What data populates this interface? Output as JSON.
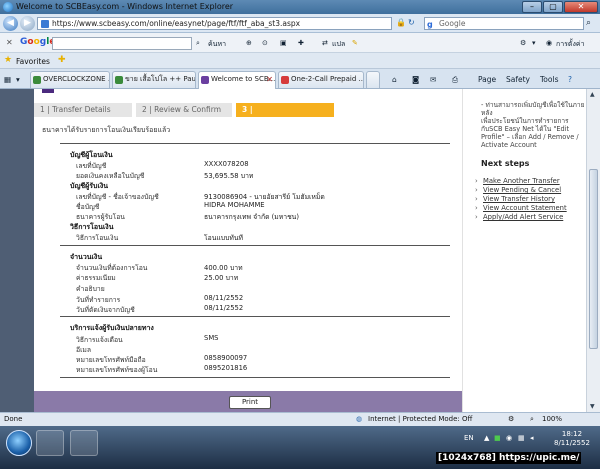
{
  "window": {
    "title": "Welcome to SCBEasy.com - Windows Internet Explorer",
    "minimize": "–",
    "maximize": "▢",
    "close": "✕"
  },
  "address": {
    "url": "https://www.scbeasy.com/online/easynet/page/ftf/ftf_aba_st3.aspx",
    "search_placeholder": "Google"
  },
  "google_bar": {
    "close": "✕",
    "logo": [
      "G",
      "o",
      "o",
      "g",
      "l",
      "e"
    ],
    "search_label": "ค้นหา",
    "translate": "แปล",
    "settings": "การตั้งค่า"
  },
  "favorites": {
    "label": "Favorites"
  },
  "tabs": [
    {
      "label": "OVERCLOCKZONE ...",
      "icon_color": "#3b8b3b"
    },
    {
      "label": "ขาย เสื้อโปโล ++ Paul...",
      "icon_color": "#3b8b3b"
    },
    {
      "label": "Welcome to SCB...",
      "icon_color": "#6b3fa0",
      "active": true
    },
    {
      "label": "One-2-Call Prepaid ...",
      "icon_color": "#d63b3b"
    }
  ],
  "commands": {
    "page": "Page",
    "safety": "Safety",
    "tools": "Tools"
  },
  "steps": [
    {
      "label": "1 | Transfer Details"
    },
    {
      "label": "2 | Review & Confirm"
    },
    {
      "label": "3 | Acknowledgements",
      "active": true
    }
  ],
  "success_message": "ธนาคารได้รับรายการโอนเงินเรียบร้อยแล้ว",
  "from_account": {
    "section": "บัญชีผู้โอนเงิน",
    "number_label": "เลขที่บัญชี",
    "number": "XXXX078208",
    "balance_label": "ยอดเงินคงเหลือในบัญชี",
    "balance": "53,695.58 บาท"
  },
  "to_account": {
    "section": "บัญชีผู้รับเงิน",
    "number_label": "เลขที่บัญชี - ชื่อเจ้าของบัญชี",
    "number": "9130086904 - นายอัยสารีย์ โมฮัมเหม็ด",
    "name_label": "ชื่อบัญชี",
    "name": "HIDRA MOHAMME",
    "bank_label": "ธนาคารผู้รับโอน",
    "bank": "ธนาคารกรุงเทพ จำกัด (มหาชน)"
  },
  "method": {
    "section": "วิธีการโอนเงิน",
    "label": "วิธีการโอนเงิน",
    "value": "โอนแบบทันที"
  },
  "amount": {
    "section": "จำนวนเงิน",
    "amount_label": "จำนวนเงินที่ต้องการโอน",
    "amount": "400.00 บาท",
    "fee_label": "ค่าธรรมเนียม",
    "fee": "25.00 บาท",
    "desc_label": "คำอธิบาย",
    "desc": "",
    "txn_date_label": "วันที่ทำรายการ",
    "txn_date": "08/11/2552",
    "debit_date_label": "วันที่ตัดเงินจากบัญชี",
    "debit_date": "08/11/2552"
  },
  "notify": {
    "section": "บริการแจ้งผู้รับเงินปลายทาง",
    "method_label": "วิธีการแจ้งเตือน",
    "method": "SMS",
    "email_label": "อีเมล",
    "email": "",
    "mobile_label": "หมายเลขโทรศัพท์มือถือ",
    "mobile": "0858900097",
    "recv_mobile_label": "หมายเลขโทรศัพท์ของผู้โอน",
    "recv_mobile": "0895201816"
  },
  "print_label": "Print",
  "right": {
    "info_lines": [
      "- ท่านสามารถเพิ่มบัญชีเพื่อใช้ในภายหลัง",
      "เพื่อประโยชน์ในการทำรายการ",
      "กับSCB Easy Net ได้ใน \"Edit",
      "Profile\" – เลือก Add / Remove /",
      "Activate Account"
    ],
    "next_steps_title": "Next steps",
    "next_steps": [
      "Make Another Transfer",
      "View Pending & Cancel",
      "View Transfer History",
      "View Account Statement",
      "Apply/Add Alert Service"
    ]
  },
  "status": {
    "done": "Done",
    "zone": "Internet | Protected Mode: Off",
    "zoom": "100%"
  },
  "taskbar": {
    "lang": "EN",
    "time": "18:12",
    "date": "8/11/2552"
  },
  "watermark": "[1024x768] https://upic.me/"
}
